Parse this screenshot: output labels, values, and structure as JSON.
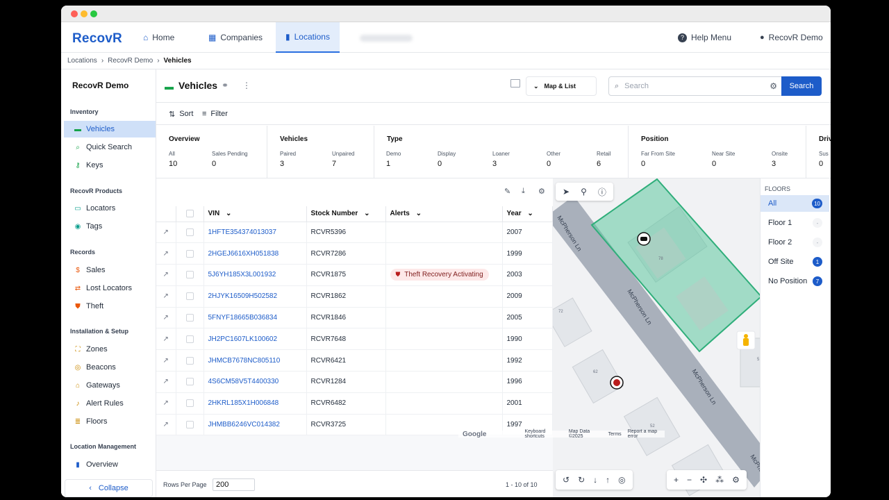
{
  "app": {
    "logo": "RecovR"
  },
  "nav": {
    "home": "Home",
    "companies": "Companies",
    "locations": "Locations",
    "help": "Help Menu",
    "user": "RecovR Demo"
  },
  "breadcrumb": [
    "Locations",
    "RecovR Demo",
    "Vehicles"
  ],
  "sidebar": {
    "title": "RecovR Demo",
    "sections": {
      "inventory": "Inventory",
      "products": "RecovR Products",
      "records": "Records",
      "setup": "Installation & Setup",
      "location": "Location Management"
    },
    "items": {
      "vehicles": "Vehicles",
      "quick_search": "Quick Search",
      "keys": "Keys",
      "locators": "Locators",
      "tags": "Tags",
      "sales": "Sales",
      "lost_locators": "Lost Locators",
      "theft": "Theft",
      "zones": "Zones",
      "beacons": "Beacons",
      "gateways": "Gateways",
      "alert_rules": "Alert Rules",
      "floors": "Floors",
      "overview": "Overview"
    },
    "collapse": "Collapse"
  },
  "header": {
    "title": "Vehicles",
    "view": "Map & List",
    "search_placeholder": "Search",
    "search_button": "Search"
  },
  "toolbar": {
    "sort": "Sort",
    "filter": "Filter"
  },
  "stats": {
    "overview": {
      "title": "Overview",
      "all_l": "All",
      "all_v": "10",
      "sp_l": "Sales Pending",
      "sp_v": "0"
    },
    "vehicles": {
      "title": "Vehicles",
      "paired_l": "Paired",
      "paired_v": "3",
      "unpaired_l": "Unpaired",
      "unpaired_v": "7"
    },
    "type": {
      "title": "Type",
      "demo_l": "Demo",
      "demo_v": "1",
      "display_l": "Display",
      "display_v": "0",
      "loaner_l": "Loaner",
      "loaner_v": "3",
      "other_l": "Other",
      "other_v": "0",
      "retail_l": "Retail",
      "retail_v": "6"
    },
    "position": {
      "title": "Position",
      "far_l": "Far From Site",
      "far_v": "0",
      "near_l": "Near Site",
      "near_v": "0",
      "onsite_l": "Onsite",
      "onsite_v": "3"
    },
    "drive": {
      "title": "Driv",
      "sus_l": "Sus",
      "sus_v": "0"
    }
  },
  "table": {
    "columns": {
      "vin": "VIN",
      "stock": "Stock Number",
      "alerts": "Alerts",
      "year": "Year"
    },
    "rows": [
      {
        "vin": "1HFTE354374013037",
        "stock": "RCVR5396",
        "alert": "",
        "year": "2007"
      },
      {
        "vin": "2HGEJ6616XH051838",
        "stock": "RCVR7286",
        "alert": "",
        "year": "1999"
      },
      {
        "vin": "5J6YH185X3L001932",
        "stock": "RCVR1875",
        "alert": "Theft Recovery Activating",
        "year": "2003"
      },
      {
        "vin": "2HJYK16509H502582",
        "stock": "RCVR1862",
        "alert": "",
        "year": "2009"
      },
      {
        "vin": "5FNYF18665B036834",
        "stock": "RCVR1846",
        "alert": "",
        "year": "2005"
      },
      {
        "vin": "JH2PC1607LK100602",
        "stock": "RCVR7648",
        "alert": "",
        "year": "1990"
      },
      {
        "vin": "JHMCB7678NC805110",
        "stock": "RCVR6421",
        "alert": "",
        "year": "1992"
      },
      {
        "vin": "4S6CM58V5T4400330",
        "stock": "RCVR1284",
        "alert": "",
        "year": "1996"
      },
      {
        "vin": "2HKRL185X1H006848",
        "stock": "RCVR6482",
        "alert": "",
        "year": "2001"
      },
      {
        "vin": "JHMBB6246VC014382",
        "stock": "RCVR3725",
        "alert": "",
        "year": "1997"
      }
    ],
    "rows_per_page_label": "Rows Per Page",
    "rows_per_page": "200",
    "range": "1 - 10 of 10"
  },
  "map": {
    "street": "McPherson Ln",
    "lots": [
      "78",
      "72",
      "62",
      "52",
      "5"
    ],
    "footer": {
      "logo": "Google",
      "shortcuts": "Keyboard shortcuts",
      "data": "Map Data ©2025",
      "terms": "Terms",
      "report": "Report a map error"
    }
  },
  "floors": {
    "title": "FLOORS",
    "items": [
      {
        "label": "All",
        "count": "10"
      },
      {
        "label": "Floor 1",
        "count": "-"
      },
      {
        "label": "Floor 2",
        "count": "-"
      },
      {
        "label": "Off Site",
        "count": "1"
      },
      {
        "label": "No Position",
        "count": "7"
      }
    ]
  },
  "colors": {
    "primary": "#1d5cc9",
    "zone": "#5ec9a0",
    "alert_bg": "#fde8e8"
  }
}
